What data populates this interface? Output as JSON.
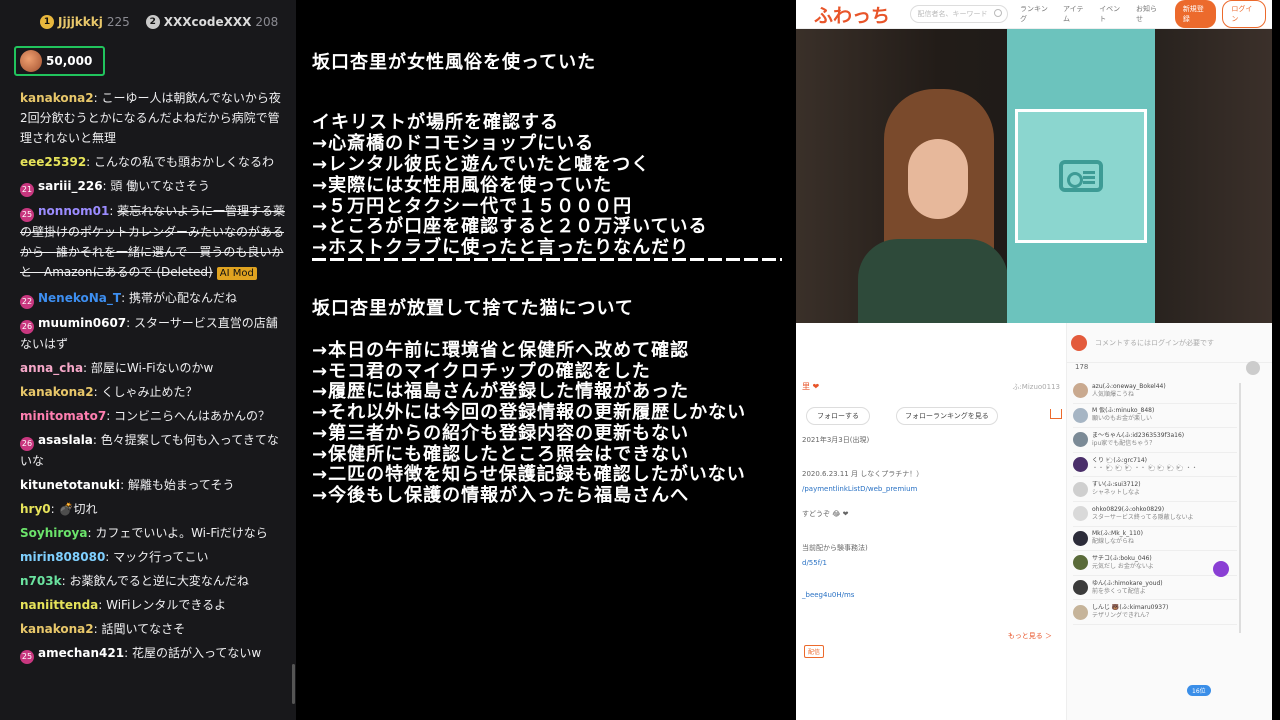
{
  "chat": {
    "top_gifters": [
      {
        "rank": "1",
        "name": "Jjjjkkkj",
        "count": "225"
      },
      {
        "rank": "2",
        "name": "XXXcodeXXX",
        "count": "208"
      }
    ],
    "bits_value": "50,000",
    "bits_progress": 0.75,
    "messages": [
      {
        "user": "kanakona2",
        "color": "#e8c76a",
        "text": "こーゆー人は朝飲んでないから夜2回分飲むうとかになるんだよねだから病院で管理されないと無理"
      },
      {
        "user": "eee25392",
        "color": "#e6e35a",
        "text": "こんなの私でも頭おかしくなるわ"
      },
      {
        "user": "sariii_226",
        "color": "#ffffff",
        "badge": "21",
        "text": "頭 働いてなさそう"
      },
      {
        "user": "nonnom01",
        "color": "#9b8cff",
        "badge": "25",
        "text": "薬忘れないように一管理する薬の壁掛けのポケットカレンダーみたいなのがあるから—誰かそれを一緒に選んで—買うのも良いかと—Amazonにあるので (Deleted)",
        "deleted": true,
        "tag": "AI Mod"
      },
      {
        "user": "NenekoNa_T",
        "color": "#3d8ef0",
        "badge": "22",
        "text": "携帯が心配なんだね"
      },
      {
        "user": "muumin0607",
        "color": "#ffffff",
        "badge": "26",
        "text": "スターサービス直営の店舗ないはず"
      },
      {
        "user": "anna_cha",
        "color": "#f5a7c8",
        "text": "部屋にWi-Fiないのかw"
      },
      {
        "user": "kanakona2",
        "color": "#e8c76a",
        "text": "くしゃみ止めた？"
      },
      {
        "user": "minitomato7",
        "color": "#ff7fb0",
        "text": "コンビニらへんはあかんの？"
      },
      {
        "user": "asaslala",
        "color": "#ffffff",
        "badge": "26",
        "text": "色々提案しても何も入ってきてないな"
      },
      {
        "user": "kitunetotanuki",
        "color": "#ffffff",
        "text": "解離も始まってそう"
      },
      {
        "user": "hry0",
        "color": "#e6e35a",
        "text": "💣切れ"
      },
      {
        "user": "Soyhiroya",
        "color": "#6be36b",
        "text": "カフェでいいよ。Wi-Fiだけなら"
      },
      {
        "user": "mirin808080",
        "color": "#7fd0ff",
        "text": "マック行ってこい"
      },
      {
        "user": "n703k",
        "color": "#6be3a0",
        "text": "お薬飲んでると逆に大変なんだね"
      },
      {
        "user": "naniittenda",
        "color": "#e6e35a",
        "text": "WiFiレンタルできるよ"
      },
      {
        "user": "kanakona2",
        "color": "#e8c76a",
        "text": "話聞いてなさそ"
      },
      {
        "user": "amechan421",
        "color": "#ffffff",
        "badge": "25",
        "text": "花屋の話が入ってないw"
      }
    ]
  },
  "notes": {
    "lines": [
      "坂口杏里が女性風俗を使っていた",
      "",
      "イキリストが場所を確認する",
      "→心斎橋のドコモショップにいる",
      "→レンタル彼氏と遊んでいたと嘘をつく",
      "→実際には女性用風俗を使っていた",
      "→５万円とタクシー代で１５０００円",
      "→ところが口座を確認すると２０万浮いている",
      "→ホストクラブに使ったと言ったりなんだり",
      "",
      "",
      "坂口杏里が放置して捨てた猫について",
      "",
      "→本日の午前に環境省と保健所へ改めて確認",
      "→モコ君のマイクロチップの確認をした",
      "→履歴には福島さんが登録した情報があった",
      "→それ以外には今回の登録情報の更新履歴しかない",
      "→第三者からの紹介も登録内容の更新もない",
      "→保健所にも確認したところ照会はできない",
      "→二匹の特徴を知らせ保護記録も確認したがいない",
      "→今後もし保護の情報が入ったら福島さんへ"
    ]
  },
  "site": {
    "logo": "ふわっち",
    "search_placeholder": "配信者名、キーワード",
    "nav": [
      "ランキング",
      "アイテム",
      "イベント",
      "お知らせ"
    ],
    "register": "新規登録",
    "login": "ログイン",
    "profile": {
      "name_fragment": "里 ❤",
      "id": "ふ:Mizuo0113",
      "follow": "フォローする",
      "follow_rank": "フォローランキングを見る",
      "date": "2021年3月3日(出現)",
      "text1": "2020.6.23.11 月 しなくプラチナ！）",
      "link1": "/paymentlinkListD/web_premium",
      "text2": "すどうぞ 😂 ❤",
      "text3": "当前配から験事務法)",
      "link2": "d/55f/1",
      "link3": "_beeg4u0H/ms",
      "more": "もっと見る ＞",
      "tag": "配信"
    },
    "comments": {
      "input_placeholder": "コメントするにはログインが必要です",
      "count": "178",
      "items": [
        {
          "name": "azu(ふ:oneway_Bokel44)",
          "text": "人気順爆こうね"
        },
        {
          "name": "M 仮(ふ:minuko_848)",
          "text": "願いのもお金が楽しい"
        },
        {
          "name": "ま〜ちゃん(ふ:id2363539f3a16)",
          "text": "ipu家でも配信ちゃう？"
        },
        {
          "name": "くり 🐑(ふ:grc714)",
          "text": "・・ 🐑 🐑 🐑 ・・ 🐑 🐑 🐑 🐑 ・・"
        },
        {
          "name": "すい(ふ:sui3712)",
          "text": "シャネットしなよ"
        },
        {
          "name": "ohko0829(ふ:ohko0829)",
          "text": "スターサービス終ってる隠蔽しないよ"
        },
        {
          "name": "Mk(ふ:Mk_k_110)",
          "text": "配線しながらね"
        },
        {
          "name": "サチコ(ふ:boku_046)",
          "text": "元気だし お金がないよ"
        },
        {
          "name": "ゆん(ふ:himokare_youd)",
          "text": "前を歩くって配信よ"
        },
        {
          "name": "しんじ 🐻(ふ:kimaru0937)",
          "text": "テザリングできれん？"
        }
      ],
      "badge": "16位"
    }
  }
}
